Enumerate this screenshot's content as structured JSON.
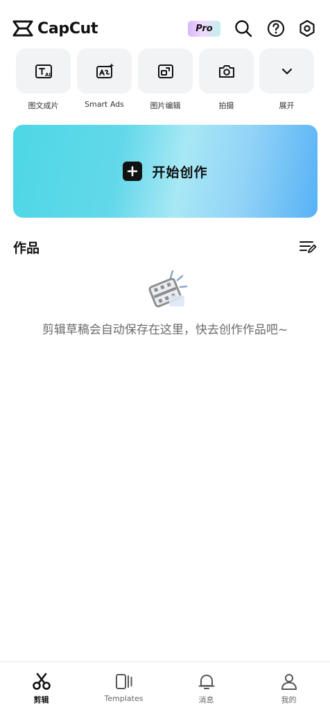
{
  "header": {
    "app_name": "CapCut",
    "pro_label": "Pro"
  },
  "tools": [
    {
      "label": "图文成片",
      "icon": "text-to-video-icon"
    },
    {
      "label": "Smart Ads",
      "icon": "smart-ads-icon"
    },
    {
      "label": "图片编辑",
      "icon": "image-edit-icon"
    },
    {
      "label": "拍摄",
      "icon": "camera-icon"
    },
    {
      "label": "展开",
      "icon": "chevron-down-icon"
    }
  ],
  "create": {
    "label": "开始创作"
  },
  "works": {
    "title": "作品",
    "empty_text": "剪辑草稿会自动保存在这里，快去创作作品吧~"
  },
  "bottom_nav": [
    {
      "label": "剪辑",
      "icon": "scissors-icon",
      "active": true
    },
    {
      "label": "Templates",
      "icon": "templates-icon",
      "active": false
    },
    {
      "label": "消息",
      "icon": "bell-icon",
      "active": false
    },
    {
      "label": "我的",
      "icon": "profile-icon",
      "active": false
    }
  ]
}
